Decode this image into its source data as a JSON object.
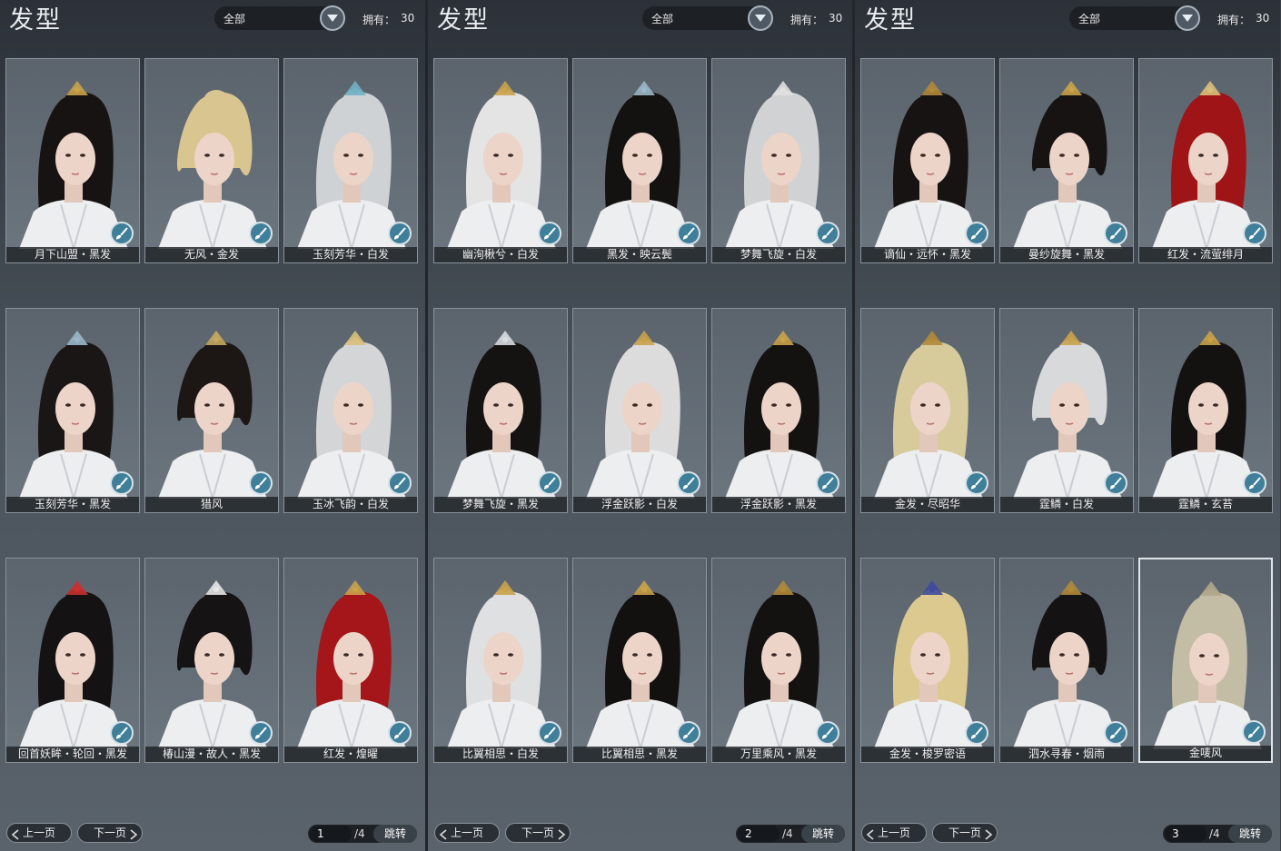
{
  "panels": [
    {
      "title": "发型",
      "filter": "全部",
      "owned_label": "拥有：",
      "owned_count": "30",
      "cards": [
        {
          "name": "月下山盟・黑发",
          "hair": "#171312",
          "accent": "#c9a24a"
        },
        {
          "name": "无风・金发",
          "hair": "#d9c58f",
          "accent": ""
        },
        {
          "name": "玉刻芳华・白发",
          "hair": "#cfd2d5",
          "accent": "#6fb1c2"
        },
        {
          "name": "玉刻芳华・黑发",
          "hair": "#1a1615",
          "accent": "#9ab8c8"
        },
        {
          "name": "猎风",
          "hair": "#1c1614",
          "accent": "#c9a860"
        },
        {
          "name": "玉冰飞韵・白发",
          "hair": "#d3d5d7",
          "accent": "#d8c07a"
        },
        {
          "name": "回首妖眸・轮回・黑发",
          "hair": "#141212",
          "accent": "#c8302e"
        },
        {
          "name": "椿山漫・故人・黑发",
          "hair": "#151313",
          "accent": "#e6e6e6"
        },
        {
          "name": "红发・煌曜",
          "hair": "#a5161a",
          "accent": "#c9a24a"
        }
      ],
      "prev_label": "上一页",
      "next_label": "下一页",
      "page_value": "1",
      "page_total": "/4",
      "jump_label": "跳转"
    },
    {
      "title": "发型",
      "filter": "全部",
      "owned_label": "拥有：",
      "owned_count": "30",
      "cards": [
        {
          "name": "幽洵楸兮・白发",
          "hair": "#e4e4e4",
          "accent": "#c9a24a"
        },
        {
          "name": "黑发・映云鬓",
          "hair": "#141211",
          "accent": "#9ab8c8"
        },
        {
          "name": "梦舞飞旋・白发",
          "hair": "#d0d2d4",
          "accent": "#e0e0e0"
        },
        {
          "name": "梦舞飞旋・黑发",
          "hair": "#151312",
          "accent": "#d8dde0"
        },
        {
          "name": "浮金跃影・白发",
          "hair": "#dcdcdc",
          "accent": "#c9a24a"
        },
        {
          "name": "浮金跃影・黑发",
          "hair": "#141211",
          "accent": "#c9a24a"
        },
        {
          "name": "比翼相思・白发",
          "hair": "#dfe0e1",
          "accent": "#c9a24a"
        },
        {
          "name": "比翼相思・黑发",
          "hair": "#131110",
          "accent": "#c9a24a"
        },
        {
          "name": "万里乘风・黑发",
          "hair": "#141211",
          "accent": "#b08a3a"
        }
      ],
      "prev_label": "上一页",
      "next_label": "下一页",
      "page_value": "2",
      "page_total": "/4",
      "jump_label": "跳转"
    },
    {
      "title": "发型",
      "filter": "全部",
      "owned_label": "拥有：",
      "owned_count": "30",
      "cards": [
        {
          "name": "谪仙・远怀・黑发",
          "hair": "#171312",
          "accent": "#b08a3a"
        },
        {
          "name": "曼纱旋舞・黑发",
          "hair": "#161312",
          "accent": "#c9a24a"
        },
        {
          "name": "红发・流萤绯月",
          "hair": "#9e1417",
          "accent": "#d8c07a"
        },
        {
          "name": "金发・尽昭华",
          "hair": "#d7cb9c",
          "accent": "#b08a3a"
        },
        {
          "name": "霆鳞・白发",
          "hair": "#d8d9da",
          "accent": "#c9a24a"
        },
        {
          "name": "霆鳞・玄苔",
          "hair": "#141211",
          "accent": "#c9a24a"
        },
        {
          "name": "金发・梭罗密语",
          "hair": "#dcc98f",
          "accent": "#3e4a9a"
        },
        {
          "name": "泗水寻春・烟雨",
          "hair": "#141212",
          "accent": "#b08a3a"
        },
        {
          "name": "金唛风",
          "hair": "#c4bda6",
          "accent": "#b0a68a"
        }
      ],
      "prev_label": "上一页",
      "next_label": "下一页",
      "page_value": "3",
      "page_total": "/4",
      "jump_label": "跳转"
    }
  ]
}
